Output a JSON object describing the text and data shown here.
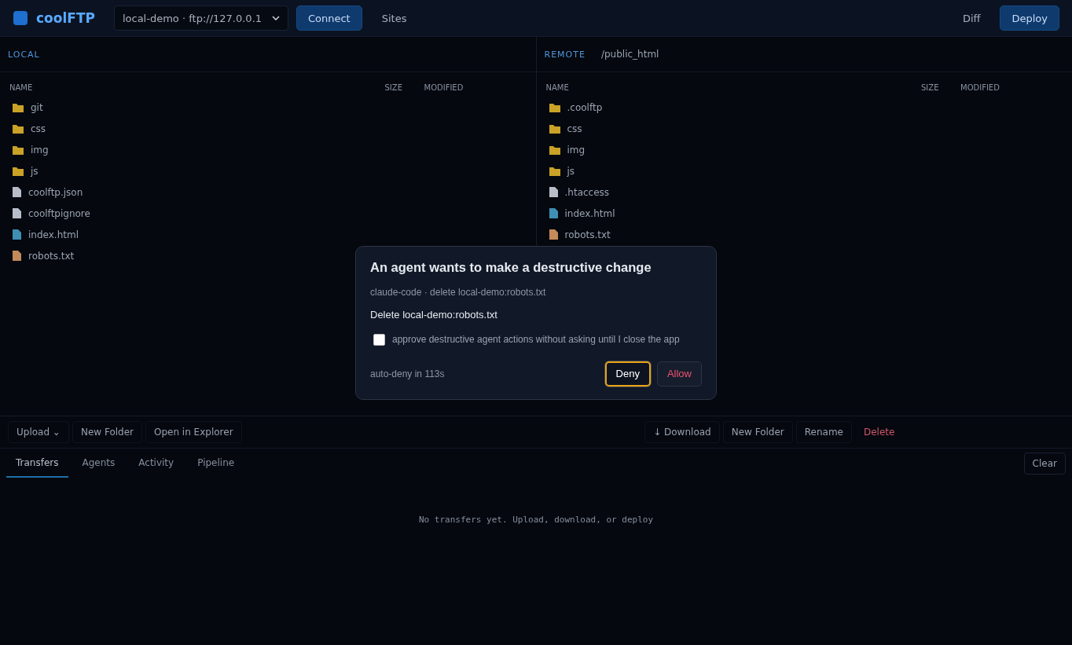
{
  "header": {
    "app_name": "coolFTP",
    "site": "local-demo · ftp://127.0.0.1",
    "buttons": [
      {
        "label": "Connect",
        "kind": "primary"
      },
      {
        "label": "Sites",
        "kind": "ghost"
      }
    ],
    "right_buttons": [
      {
        "label": "Diff",
        "kind": "ghost"
      },
      {
        "label": "Deploy",
        "kind": "primary"
      }
    ]
  },
  "panes": [
    {
      "label": "LOCAL",
      "columns": [
        "NAME",
        "SIZE",
        "MODIFIED"
      ],
      "rows": [
        {
          "name": "git",
          "kind": "folder"
        },
        {
          "name": "css",
          "kind": "folder"
        },
        {
          "name": "img",
          "kind": "folder"
        },
        {
          "name": "js",
          "kind": "folder"
        },
        {
          "name": "coolftp.json",
          "kind": "file"
        },
        {
          "name": "coolftpignore",
          "kind": "file"
        },
        {
          "name": "index.html",
          "kind": "html"
        },
        {
          "name": "robots.txt",
          "kind": "text"
        }
      ]
    },
    {
      "label": "REMOTE",
      "path": "/public_html",
      "columns": [
        "NAME",
        "SIZE",
        "MODIFIED"
      ],
      "rows": [
        {
          "name": ".coolftp",
          "kind": "folder"
        },
        {
          "name": "css",
          "kind": "folder"
        },
        {
          "name": "img",
          "kind": "folder"
        },
        {
          "name": "js",
          "kind": "folder"
        },
        {
          "name": ".htaccess",
          "kind": "file"
        },
        {
          "name": "index.html",
          "kind": "html"
        },
        {
          "name": "robots.txt",
          "kind": "text"
        }
      ]
    }
  ],
  "toolbar": {
    "left": [
      {
        "label": "Upload ⌄",
        "kind": "normal"
      },
      {
        "label": "New Folder",
        "kind": "normal"
      },
      {
        "label": "Open in Explorer",
        "kind": "normal"
      }
    ],
    "right": [
      {
        "label": "↓ Download",
        "kind": "normal"
      },
      {
        "label": "New Folder",
        "kind": "normal"
      },
      {
        "label": "Rename",
        "kind": "normal"
      },
      {
        "label": "Delete",
        "kind": "danger"
      }
    ]
  },
  "bottom_tabs": [
    {
      "label": "Transfers",
      "selected": true
    },
    {
      "label": "Agents",
      "selected": false
    },
    {
      "label": "Activity",
      "selected": false
    },
    {
      "label": "Pipeline",
      "selected": false
    }
  ],
  "clear_button": "Clear",
  "empty_message": "No transfers yet. Upload, download, or deploy",
  "dialog": {
    "title": "An agent wants to make a destructive change",
    "subtitle": "claude-code · delete local-demo:robots.txt",
    "action": "Delete local-demo:robots.txt",
    "checkbox": {
      "label": "approve destructive agent actions without asking until I close the app",
      "checked": false
    },
    "countdown": "auto-deny in 113s",
    "buttons": [
      {
        "label": "Deny",
        "kind": "neutral",
        "focused": true
      },
      {
        "label": "Allow",
        "kind": "danger",
        "focused": false
      }
    ]
  }
}
